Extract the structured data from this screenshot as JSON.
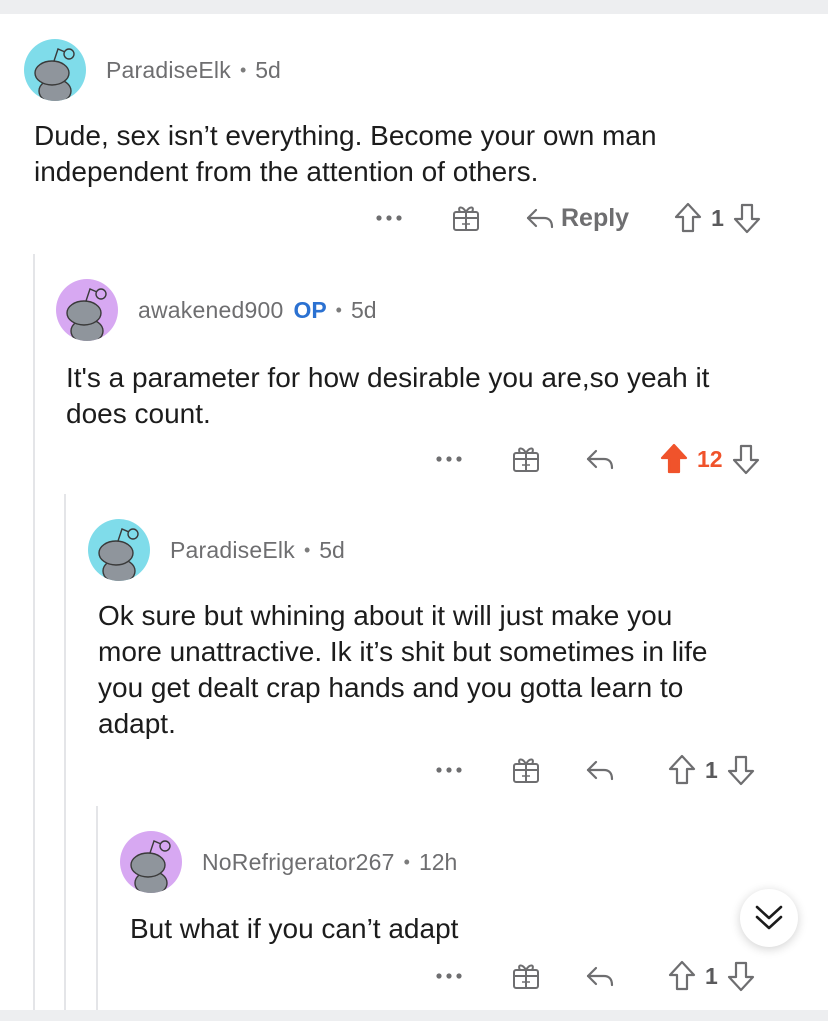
{
  "colors": {
    "accent_upvote": "#f0532b",
    "op_badge": "#2b71d1",
    "meta_text": "#6e6e70",
    "avatar_cyan": "#7fdcea",
    "avatar_purple": "#d7a8f2"
  },
  "comments": [
    {
      "username": "ParadiseElk",
      "op_badge": "",
      "separator": "•",
      "age": "5d",
      "body": "Dude, sex isn’t everything. Become your own man\nindependent from the attention of others.",
      "more_label": "•••",
      "reply_label": "Reply",
      "score": "1",
      "upvoted": false,
      "avatar_color": "cyan"
    },
    {
      "username": "awakened900",
      "op_badge": "OP",
      "separator": "•",
      "age": "5d",
      "body": "It's a parameter for how desirable you are,so yeah it\ndoes count.",
      "more_label": "•••",
      "reply_label": "",
      "score": "12",
      "upvoted": true,
      "avatar_color": "purple"
    },
    {
      "username": "ParadiseElk",
      "op_badge": "",
      "separator": "•",
      "age": "5d",
      "body": "Ok sure but whining about it will just make you\nmore unattractive. Ik it’s shit but sometimes in life\nyou get dealt crap hands and you gotta learn to\nadapt.",
      "more_label": "•••",
      "reply_label": "",
      "score": "1",
      "upvoted": false,
      "avatar_color": "cyan"
    },
    {
      "username": "NoRefrigerator267",
      "op_badge": "",
      "separator": "•",
      "age": "12h",
      "body": "But what if you can’t adapt",
      "more_label": "•••",
      "reply_label": "",
      "score": "1",
      "upvoted": false,
      "avatar_color": "purple"
    }
  ],
  "icons": {
    "avatar": "snoo-avatar-icon",
    "award": "gift-award-icon",
    "reply": "reply-arrow-icon",
    "upvote": "upvote-arrow-icon",
    "downvote": "downvote-arrow-icon",
    "jump": "double-chevron-down-icon"
  }
}
